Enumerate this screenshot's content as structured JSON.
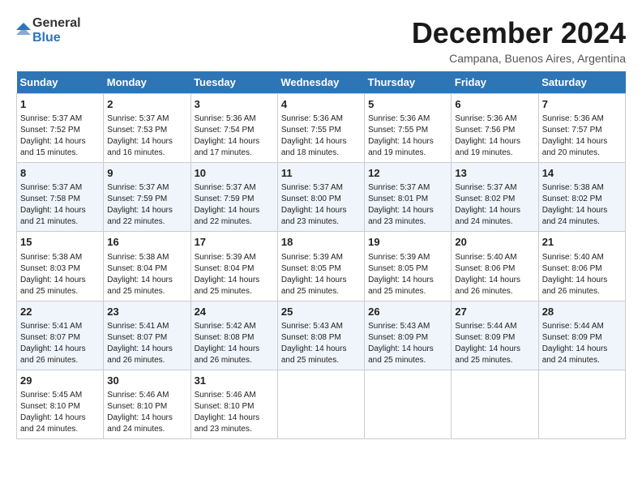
{
  "header": {
    "logo_line1": "General",
    "logo_line2": "Blue",
    "month_title": "December 2024",
    "location": "Campana, Buenos Aires, Argentina"
  },
  "days_of_week": [
    "Sunday",
    "Monday",
    "Tuesday",
    "Wednesday",
    "Thursday",
    "Friday",
    "Saturday"
  ],
  "weeks": [
    [
      {
        "day": "1",
        "content": "Sunrise: 5:37 AM\nSunset: 7:52 PM\nDaylight: 14 hours\nand 15 minutes."
      },
      {
        "day": "2",
        "content": "Sunrise: 5:37 AM\nSunset: 7:53 PM\nDaylight: 14 hours\nand 16 minutes."
      },
      {
        "day": "3",
        "content": "Sunrise: 5:36 AM\nSunset: 7:54 PM\nDaylight: 14 hours\nand 17 minutes."
      },
      {
        "day": "4",
        "content": "Sunrise: 5:36 AM\nSunset: 7:55 PM\nDaylight: 14 hours\nand 18 minutes."
      },
      {
        "day": "5",
        "content": "Sunrise: 5:36 AM\nSunset: 7:55 PM\nDaylight: 14 hours\nand 19 minutes."
      },
      {
        "day": "6",
        "content": "Sunrise: 5:36 AM\nSunset: 7:56 PM\nDaylight: 14 hours\nand 19 minutes."
      },
      {
        "day": "7",
        "content": "Sunrise: 5:36 AM\nSunset: 7:57 PM\nDaylight: 14 hours\nand 20 minutes."
      }
    ],
    [
      {
        "day": "8",
        "content": "Sunrise: 5:37 AM\nSunset: 7:58 PM\nDaylight: 14 hours\nand 21 minutes."
      },
      {
        "day": "9",
        "content": "Sunrise: 5:37 AM\nSunset: 7:59 PM\nDaylight: 14 hours\nand 22 minutes."
      },
      {
        "day": "10",
        "content": "Sunrise: 5:37 AM\nSunset: 7:59 PM\nDaylight: 14 hours\nand 22 minutes."
      },
      {
        "day": "11",
        "content": "Sunrise: 5:37 AM\nSunset: 8:00 PM\nDaylight: 14 hours\nand 23 minutes."
      },
      {
        "day": "12",
        "content": "Sunrise: 5:37 AM\nSunset: 8:01 PM\nDaylight: 14 hours\nand 23 minutes."
      },
      {
        "day": "13",
        "content": "Sunrise: 5:37 AM\nSunset: 8:02 PM\nDaylight: 14 hours\nand 24 minutes."
      },
      {
        "day": "14",
        "content": "Sunrise: 5:38 AM\nSunset: 8:02 PM\nDaylight: 14 hours\nand 24 minutes."
      }
    ],
    [
      {
        "day": "15",
        "content": "Sunrise: 5:38 AM\nSunset: 8:03 PM\nDaylight: 14 hours\nand 25 minutes."
      },
      {
        "day": "16",
        "content": "Sunrise: 5:38 AM\nSunset: 8:04 PM\nDaylight: 14 hours\nand 25 minutes."
      },
      {
        "day": "17",
        "content": "Sunrise: 5:39 AM\nSunset: 8:04 PM\nDaylight: 14 hours\nand 25 minutes."
      },
      {
        "day": "18",
        "content": "Sunrise: 5:39 AM\nSunset: 8:05 PM\nDaylight: 14 hours\nand 25 minutes."
      },
      {
        "day": "19",
        "content": "Sunrise: 5:39 AM\nSunset: 8:05 PM\nDaylight: 14 hours\nand 25 minutes."
      },
      {
        "day": "20",
        "content": "Sunrise: 5:40 AM\nSunset: 8:06 PM\nDaylight: 14 hours\nand 26 minutes."
      },
      {
        "day": "21",
        "content": "Sunrise: 5:40 AM\nSunset: 8:06 PM\nDaylight: 14 hours\nand 26 minutes."
      }
    ],
    [
      {
        "day": "22",
        "content": "Sunrise: 5:41 AM\nSunset: 8:07 PM\nDaylight: 14 hours\nand 26 minutes."
      },
      {
        "day": "23",
        "content": "Sunrise: 5:41 AM\nSunset: 8:07 PM\nDaylight: 14 hours\nand 26 minutes."
      },
      {
        "day": "24",
        "content": "Sunrise: 5:42 AM\nSunset: 8:08 PM\nDaylight: 14 hours\nand 26 minutes."
      },
      {
        "day": "25",
        "content": "Sunrise: 5:43 AM\nSunset: 8:08 PM\nDaylight: 14 hours\nand 25 minutes."
      },
      {
        "day": "26",
        "content": "Sunrise: 5:43 AM\nSunset: 8:09 PM\nDaylight: 14 hours\nand 25 minutes."
      },
      {
        "day": "27",
        "content": "Sunrise: 5:44 AM\nSunset: 8:09 PM\nDaylight: 14 hours\nand 25 minutes."
      },
      {
        "day": "28",
        "content": "Sunrise: 5:44 AM\nSunset: 8:09 PM\nDaylight: 14 hours\nand 24 minutes."
      }
    ],
    [
      {
        "day": "29",
        "content": "Sunrise: 5:45 AM\nSunset: 8:10 PM\nDaylight: 14 hours\nand 24 minutes."
      },
      {
        "day": "30",
        "content": "Sunrise: 5:46 AM\nSunset: 8:10 PM\nDaylight: 14 hours\nand 24 minutes."
      },
      {
        "day": "31",
        "content": "Sunrise: 5:46 AM\nSunset: 8:10 PM\nDaylight: 14 hours\nand 23 minutes."
      },
      {
        "day": "",
        "content": ""
      },
      {
        "day": "",
        "content": ""
      },
      {
        "day": "",
        "content": ""
      },
      {
        "day": "",
        "content": ""
      }
    ]
  ]
}
